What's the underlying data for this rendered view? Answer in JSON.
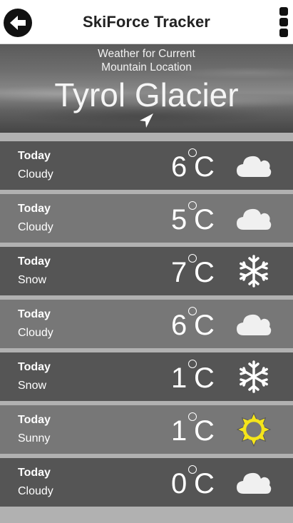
{
  "header": {
    "title": "SkiForce Tracker",
    "back_icon": "arrow-left-icon",
    "menu_icon": "more-vertical-icon"
  },
  "hero": {
    "subtitle_line1": "Weather for Current",
    "subtitle_line2": "Mountain Location",
    "location": "Tyrol Glacier",
    "location_icon": "navigation-arrow-icon"
  },
  "forecast": [
    {
      "day": "Today",
      "condition": "Cloudy",
      "temp": "6",
      "unit": "C",
      "icon": "cloud-icon"
    },
    {
      "day": "Today",
      "condition": "Cloudy",
      "temp": "5",
      "unit": "C",
      "icon": "cloud-icon"
    },
    {
      "day": "Today",
      "condition": "Snow",
      "temp": "7",
      "unit": "C",
      "icon": "snowflake-icon"
    },
    {
      "day": "Today",
      "condition": "Cloudy",
      "temp": "6",
      "unit": "C",
      "icon": "cloud-icon"
    },
    {
      "day": "Today",
      "condition": "Snow",
      "temp": "1",
      "unit": "C",
      "icon": "snowflake-icon"
    },
    {
      "day": "Today",
      "condition": "Sunny",
      "temp": "1",
      "unit": "C",
      "icon": "sun-icon"
    },
    {
      "day": "Today",
      "condition": "Cloudy",
      "temp": "0",
      "unit": "C",
      "icon": "cloud-icon"
    }
  ],
  "colors": {
    "row_dark": "#555555",
    "row_light": "#777777",
    "sun": "#f5e51a",
    "background": "#b1b1b1"
  }
}
